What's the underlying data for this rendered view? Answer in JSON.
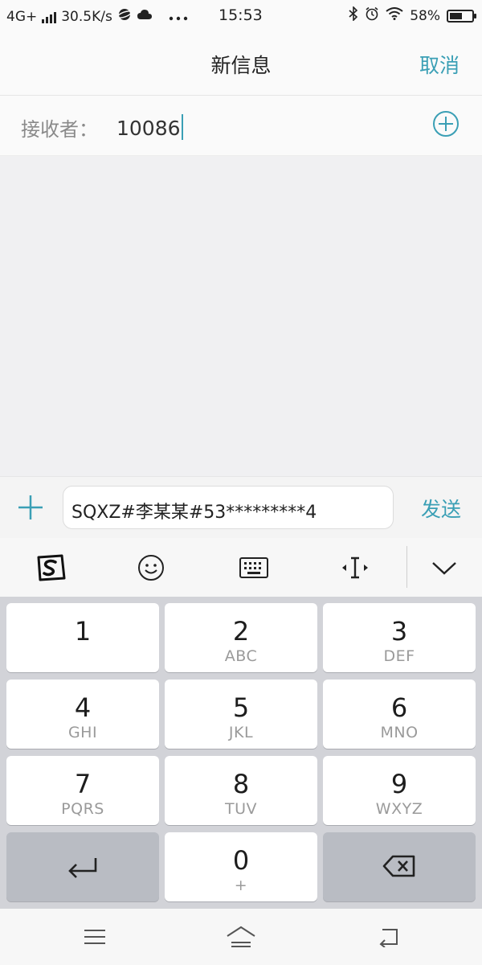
{
  "status_bar": {
    "network": "4G+",
    "speed": "30.5K/s",
    "time": "15:53",
    "battery": "58%",
    "battery_level": 0.58,
    "icons": [
      "signal-icon",
      "planet-icon",
      "cloud-icon",
      "more-dots-icon",
      "bluetooth-icon",
      "alarm-icon",
      "wifi-icon",
      "battery-icon"
    ]
  },
  "header": {
    "title": "新信息",
    "cancel_label": "取消"
  },
  "recipient": {
    "label": "接收者：",
    "value": "10086",
    "add_icon": "add-contact-icon"
  },
  "compose": {
    "message": "SQXZ#李某某#53*********4",
    "send_label": "发送",
    "attach_icon": "plus-icon"
  },
  "ime_toolbar": {
    "icons": [
      "sogou-logo-icon",
      "emoji-icon",
      "keyboard-icon",
      "cursor-move-icon",
      "collapse-keyboard-icon"
    ]
  },
  "keypad": {
    "keys": [
      {
        "num": "1",
        "sub": ""
      },
      {
        "num": "2",
        "sub": "ABC"
      },
      {
        "num": "3",
        "sub": "DEF"
      },
      {
        "num": "4",
        "sub": "GHI"
      },
      {
        "num": "5",
        "sub": "JKL"
      },
      {
        "num": "6",
        "sub": "MNO"
      },
      {
        "num": "7",
        "sub": "PQRS"
      },
      {
        "num": "8",
        "sub": "TUV"
      },
      {
        "num": "9",
        "sub": "WXYZ"
      },
      {
        "num": "0",
        "sub": "+"
      }
    ],
    "enter_icon": "enter-icon",
    "delete_icon": "backspace-icon"
  },
  "nav_bar": {
    "icons": [
      "menu-icon",
      "home-icon",
      "back-icon"
    ]
  },
  "colors": {
    "accent": "#3a9fb5",
    "keypad_bg": "#d2d3d8",
    "dark_key": "#b9bcc3"
  }
}
